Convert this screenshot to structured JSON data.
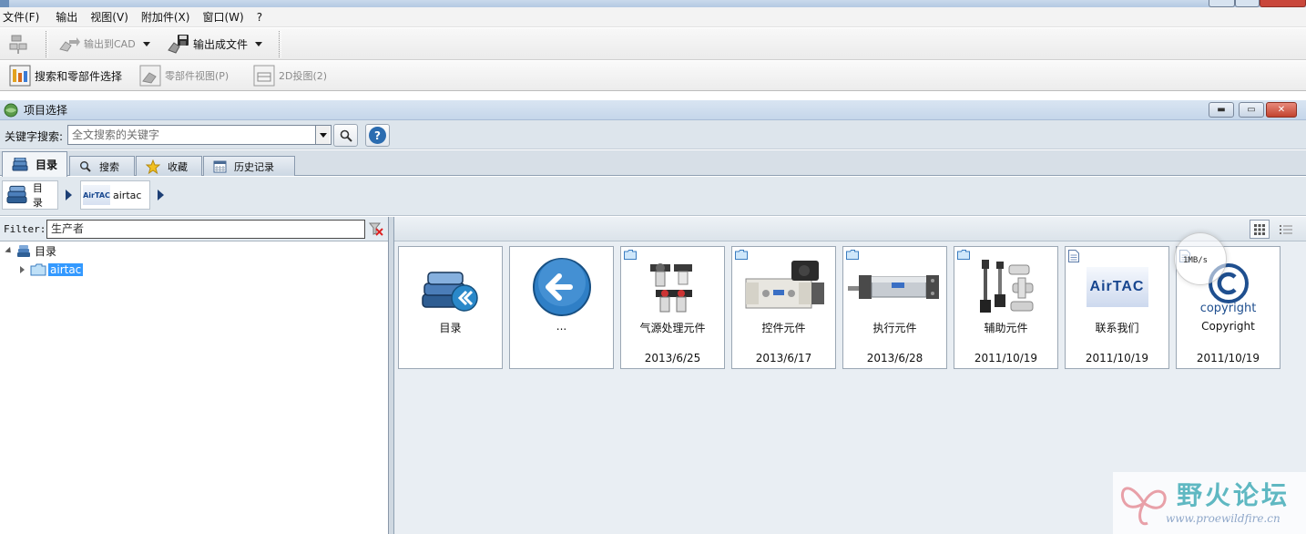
{
  "menubar": {
    "items": [
      "文件(F)",
      "输出",
      "视图(V)",
      "附加件(X)",
      "窗口(W)",
      "?"
    ]
  },
  "toolbar1": {
    "export_cad_label": "输出到CAD",
    "export_file_label": "输出成文件"
  },
  "toolbar2": {
    "search_select_label": "搜索和零部件选择",
    "part_view_label": "零部件视图(P)",
    "view_2d_label": "2D投图(2)"
  },
  "panel": {
    "title": "项目选择"
  },
  "search": {
    "label": "关键字搜索:",
    "placeholder": "全文搜索的关键字",
    "help_glyph": "?"
  },
  "tabs": [
    {
      "label": "目录",
      "active": true
    },
    {
      "label": "搜索",
      "active": false
    },
    {
      "label": "收藏",
      "active": false
    },
    {
      "label": "历史记录",
      "active": false
    }
  ],
  "breadcrumb": {
    "items": [
      "目录",
      "airtac"
    ],
    "logo_text": "AirTAC"
  },
  "filter": {
    "label": "Filter:",
    "value": "生产者"
  },
  "tree": {
    "root_label": "目录",
    "child_label": "airtac"
  },
  "cards": [
    {
      "name": "目录",
      "date": "",
      "kind": "catalog"
    },
    {
      "name": "...",
      "date": "",
      "kind": "back"
    },
    {
      "name": "气源处理元件",
      "date": "2013/6/25",
      "kind": "folder"
    },
    {
      "name": "控件元件",
      "date": "2013/6/17",
      "kind": "folder"
    },
    {
      "name": "执行元件",
      "date": "2013/6/28",
      "kind": "folder"
    },
    {
      "name": "辅助元件",
      "date": "2011/10/19",
      "kind": "folder"
    },
    {
      "name": "联系我们",
      "date": "2011/10/19",
      "kind": "document"
    },
    {
      "name": "Copyright",
      "date": "2011/10/19",
      "kind": "document"
    }
  ],
  "card_images": {
    "airtac_logo": "AirTAC",
    "copyright_text": "copyright"
  },
  "overlay": {
    "speed": "1MB/s"
  },
  "watermark": {
    "title": "野火论坛",
    "url": "www.proewildfire.cn"
  },
  "colors": {
    "accent": "#3399ff",
    "nav_arrow": "#1d3f75",
    "back_button": "#2f7fc6"
  }
}
